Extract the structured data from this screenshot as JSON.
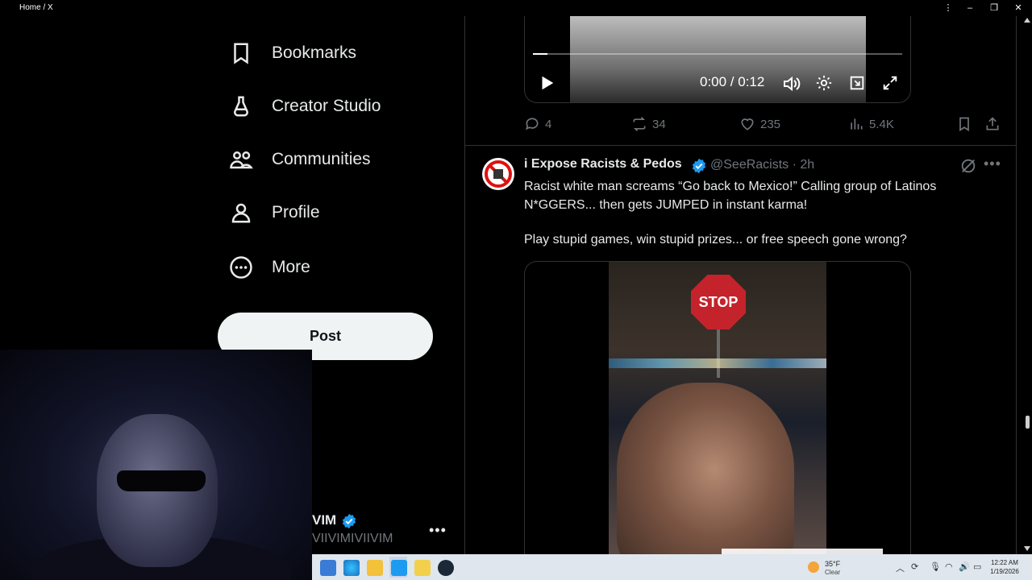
{
  "window": {
    "title": "Home / X"
  },
  "sidebar": {
    "items": [
      {
        "label": "Bookmarks",
        "icon": "bookmark-icon"
      },
      {
        "label": "Creator Studio",
        "icon": "flask-icon"
      },
      {
        "label": "Communities",
        "icon": "people-icon"
      },
      {
        "label": "Profile",
        "icon": "person-icon"
      },
      {
        "label": "More",
        "icon": "more-circle-icon"
      }
    ],
    "post_label": "Post",
    "account": {
      "name": "VIM",
      "handle": "VIIVIMIVIIVIM"
    }
  },
  "video_tweet": {
    "player": {
      "time": "0:00 / 0:12",
      "progress": 0.0
    },
    "stats": {
      "replies": "4",
      "reposts": "34",
      "likes": "235",
      "views": "5.4K"
    }
  },
  "tweet": {
    "author": "i Expose Racists & Pedos",
    "handle": "@SeeRacists",
    "time": "· 2h",
    "text_line1": "Racist white man screams “Go back to Mexico!” Calling group of Latinos N*GGERS... then gets JUMPED in instant karma!",
    "text_line2": "Play stupid games, win stupid prizes... or free speech gone wrong?",
    "media": {
      "sign_text": "STOP"
    }
  },
  "taskbar": {
    "weather": {
      "temp": "35°F",
      "desc": "Clear"
    },
    "clock": {
      "time": "12:22 AM",
      "date": "1/19/2026"
    }
  },
  "colors": {
    "background": "#000000",
    "text": "#e7e9ea",
    "muted": "#71767b",
    "verified": "#1d9bf0",
    "border": "#2f3336"
  }
}
